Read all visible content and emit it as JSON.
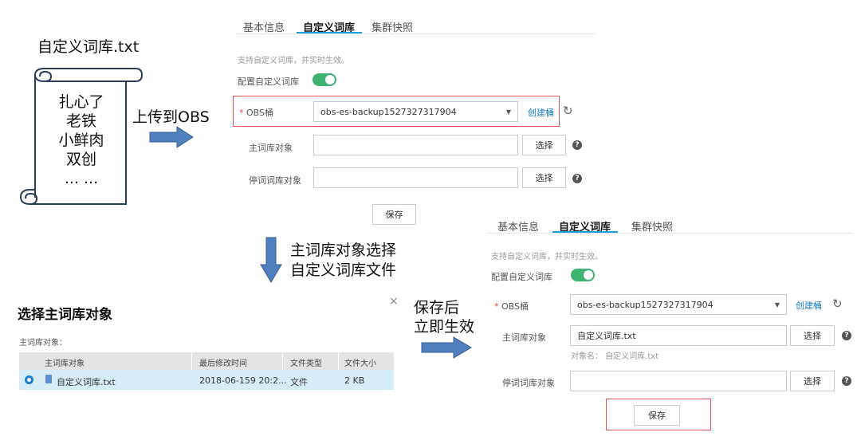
{
  "scroll": {
    "filename": "自定义词库.txt",
    "lines": [
      "扎心了",
      "老铁",
      "小鲜肉",
      "双创",
      "... ..."
    ]
  },
  "annotations": {
    "upload": "上传到OBS",
    "select_line1": "主词库对象选择",
    "select_line2": "自定义词库文件",
    "save_line1": "保存后",
    "save_line2": "立即生效"
  },
  "panel_top": {
    "tabs": [
      "基本信息",
      "自定义词库",
      "集群快照"
    ],
    "active_tab": 1,
    "hint": "支持自定义词库，并实时生效。",
    "toggle_label": "配置自定义词库",
    "obs_label": "OBS桶",
    "obs_value": "obs-es-backup1527327317904",
    "create_bucket": "创建桶",
    "main_label": "主词库对象",
    "main_value": "",
    "stop_label": "停词词库对象",
    "stop_value": "",
    "select_btn": "选择",
    "save_btn": "保存"
  },
  "panel_bottom": {
    "tabs": [
      "基本信息",
      "自定义词库",
      "集群快照"
    ],
    "active_tab": 1,
    "hint": "支持自定义词库，并实时生效。",
    "toggle_label": "配置自定义词库",
    "obs_label": "OBS桶",
    "obs_value": "obs-es-backup1527327317904",
    "create_bucket": "创建桶",
    "main_label": "主词库对象",
    "main_value": "自定义词库.txt",
    "object_name": "对象名：  自定义词库.txt",
    "stop_label": "停词词库对象",
    "stop_value": "",
    "select_btn": "选择",
    "save_btn": "保存"
  },
  "dialog": {
    "title": "选择主词库对象",
    "close": "×",
    "subtitle": "主词库对象：",
    "columns": [
      "主词库对象",
      "最后修改时间",
      "文件类型",
      "文件大小"
    ],
    "rows": [
      {
        "name": "自定义词库.txt",
        "modified": "2018-06-159 20:2...",
        "type": "文件",
        "size": "2 KB"
      }
    ]
  }
}
